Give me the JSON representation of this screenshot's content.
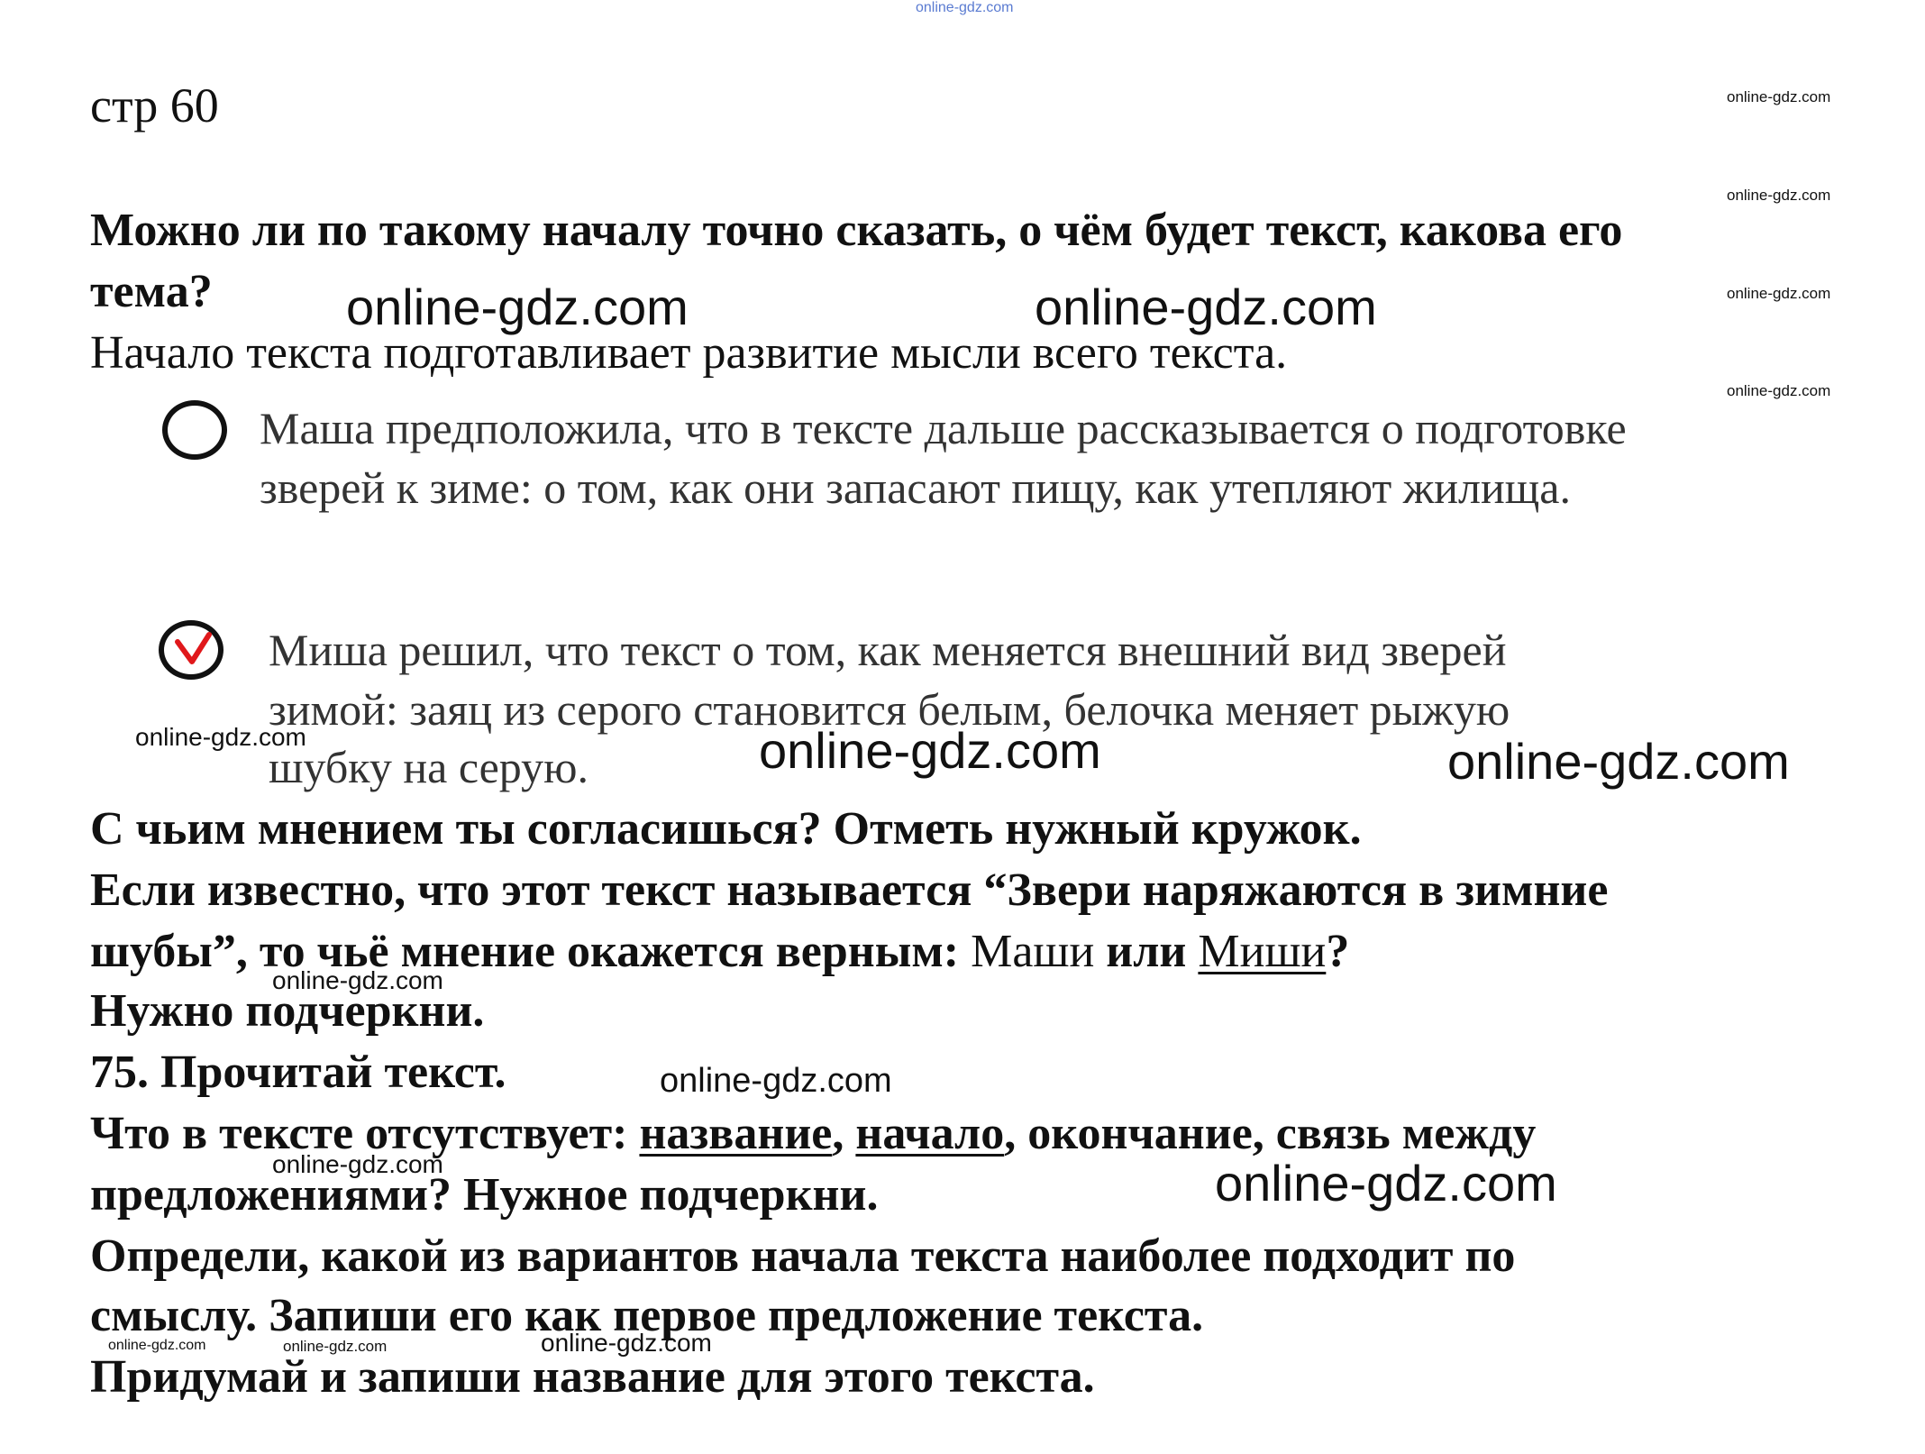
{
  "watermark": "online-gdz.com",
  "watermark_top": "online-gdz.com",
  "page_label": "стр 60",
  "q1": {
    "line1": "Можно ли по такому началу точно сказать, о чём будет текст, какова его",
    "line2": "тема?"
  },
  "answer1": "Начало текста подготавливает развитие мысли всего текста.",
  "option_masha": {
    "line1": "Маша предположила, что в тексте дальше рассказывается о подготовке",
    "line2": "зверей к зиме: о том, как они запасают пищу, как утепляют жилища."
  },
  "option_misha": {
    "line1": "Миша решил, что текст о том, как меняется внешний вид зверей",
    "line2": "зимой: заяц из серого становится белым, белочка меняет рыжую",
    "line3": "шубку на серую."
  },
  "q2": "С чьим мнением ты согласишься? Отметь нужный кружок.",
  "q3": {
    "line1": "Если известно, что этот текст называется “Звери наряжаются в зимние",
    "line2_bold": "шубы”, то чьё мнение окажется верным:",
    "opt_a": "Маши",
    "or": "или",
    "opt_b": "Миши",
    "qmark": "?",
    "line3": "Нужно подчеркни."
  },
  "task75": {
    "title": "75. Прочитай текст.",
    "q_prefix": "Что в тексте отсутствует:",
    "opt1": "название",
    "comma": ",",
    "opt2": "начало",
    "q_rest": ", окончание, связь между",
    "line2": "предложениями? Нужное подчеркни.",
    "line3": "Определи, какой из вариантов начала текста наиболее подходит по",
    "line4": "смыслу. Запиши его как первое предложение текста.",
    "line5": "Придумай и запиши название для этого текста."
  }
}
